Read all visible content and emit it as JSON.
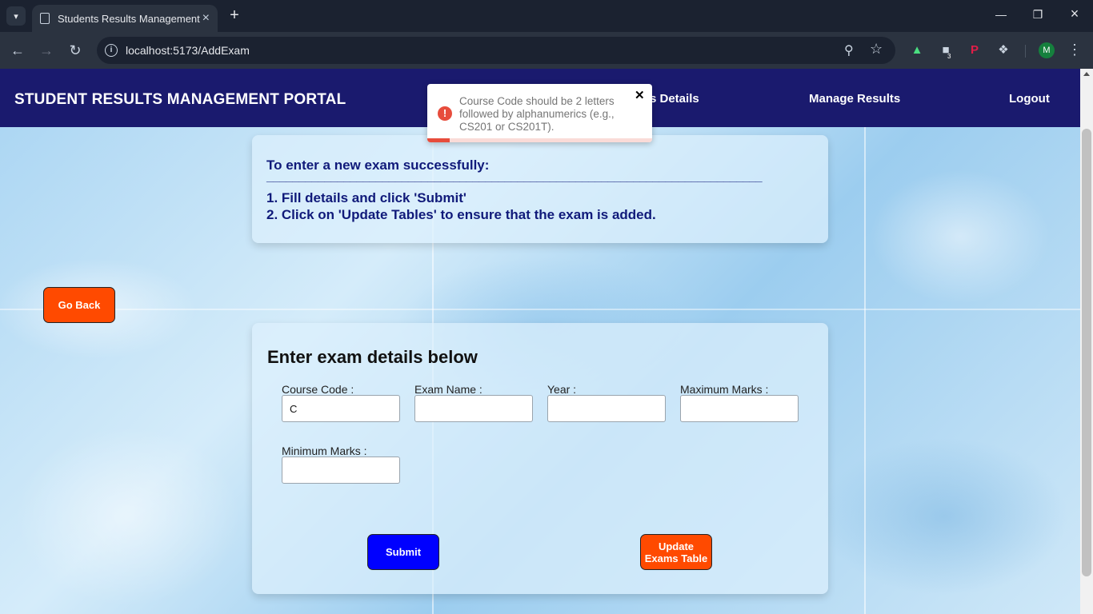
{
  "browser": {
    "tab_title": "Students Results Management Portal",
    "url": "localhost:5173/AddExam",
    "avatar_initial": "M",
    "extension_badge": "3"
  },
  "navbar": {
    "brand": "STUDENT RESULTS MANAGEMENT PORTAL",
    "links": [
      "s Details",
      "Manage Results",
      "Logout"
    ]
  },
  "toast": {
    "type": "error",
    "message": "Course Code should be 2 letters followed by alphanumerics (e.g., CS201 or CS201T).",
    "progress": 0.1
  },
  "instructions": {
    "heading": "To enter a new exam successfully:",
    "divider": "_____________________________________________________________________________",
    "step1": "1. Fill details and click 'Submit'",
    "step2": "2. Click on 'Update Tables' to ensure that the exam is added."
  },
  "go_back_label": "Go Back",
  "form": {
    "title": "Enter exam details below",
    "fields": [
      {
        "label": "Course Code :",
        "value": "C"
      },
      {
        "label": "Exam Name :",
        "value": ""
      },
      {
        "label": "Year :",
        "value": ""
      },
      {
        "label": "Maximum Marks :",
        "value": ""
      },
      {
        "label": "Minimum Marks :",
        "value": ""
      }
    ],
    "submit_label": "Submit",
    "update_label_line1": "Update",
    "update_label_line2": "Exams Table"
  },
  "colors": {
    "navbar_bg": "#1a1a6e",
    "accent_orange": "#ff4a00",
    "submit_blue": "#0000ff",
    "error_red": "#e74c3c",
    "instruction_text": "#101a7a"
  }
}
